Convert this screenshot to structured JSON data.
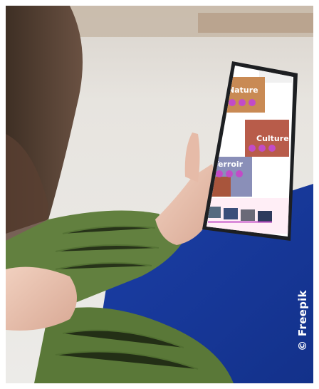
{
  "photo": {
    "credit": "© Freepik"
  },
  "phone_screen": {
    "sections": [
      {
        "title": "Nature",
        "bg": "#c98a54",
        "icon_color": "#c24bc7"
      },
      {
        "title": "Culture",
        "bg": "#b85c4a",
        "icon_color": "#c24bc7"
      },
      {
        "title": "Terroir",
        "bg": "#8a8fb8",
        "icon_color": "#c24bc7"
      }
    ],
    "footer_bg": "#ffeef6"
  },
  "colors": {
    "table": "#1a3a9e",
    "sweater": "#5f7a3f",
    "wall": "#ddd6cf",
    "phone": "#1d1f22"
  }
}
